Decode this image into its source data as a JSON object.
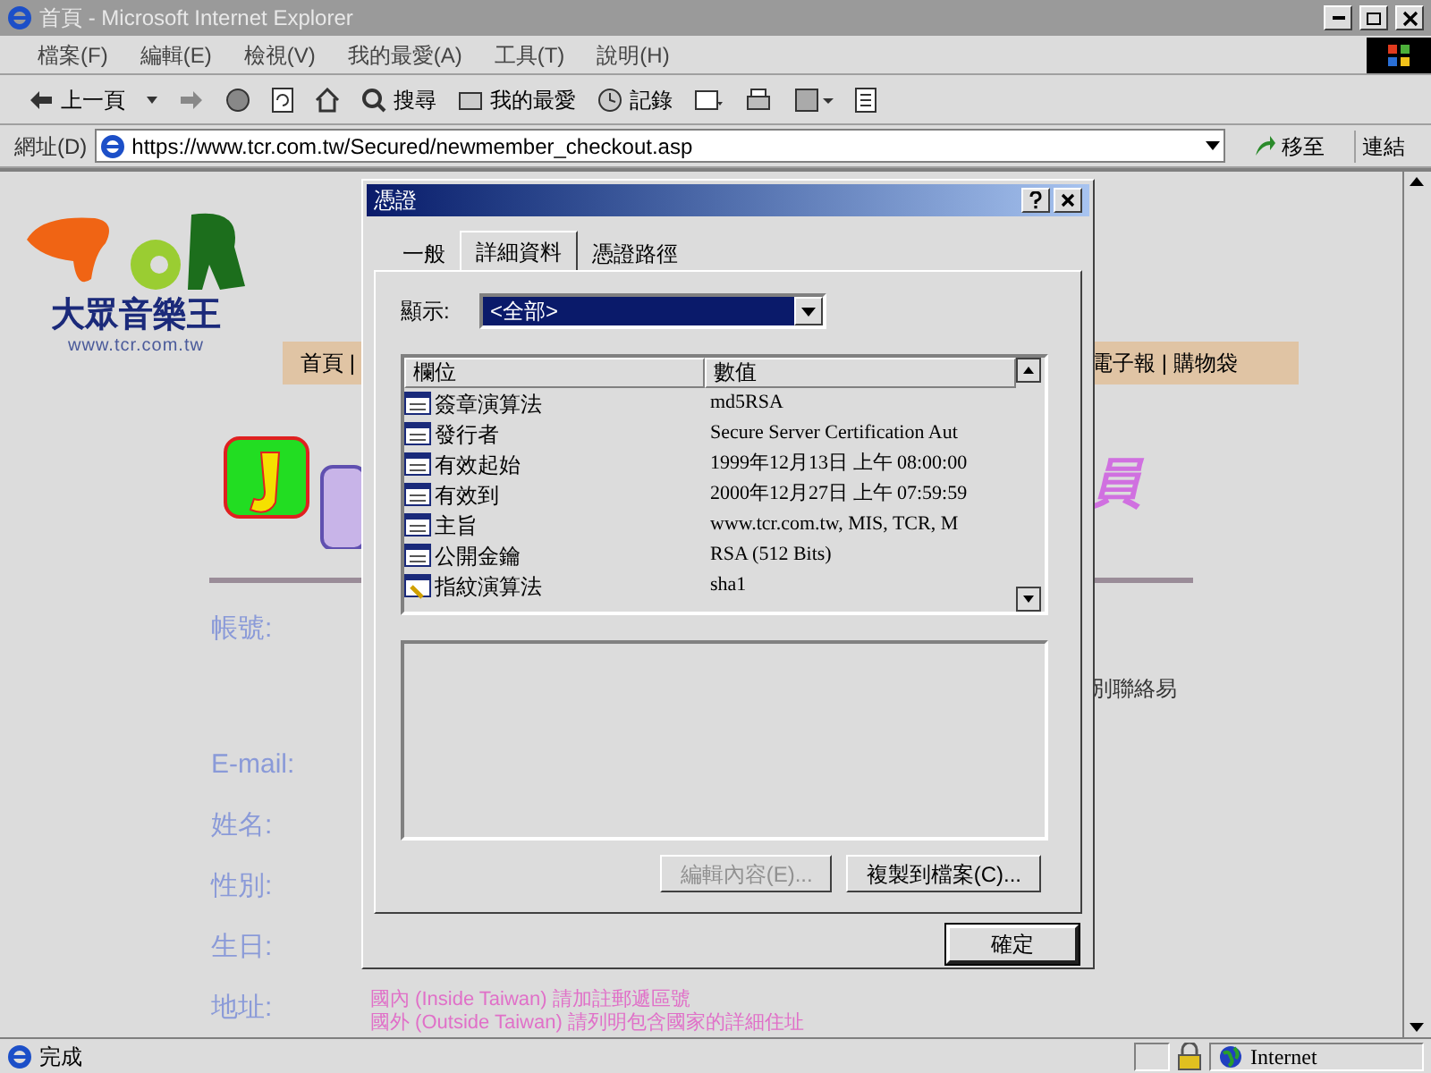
{
  "window": {
    "title": "首頁 - Microsoft Internet Explorer"
  },
  "menu_bar": [
    "檔案(F)",
    "編輯(E)",
    "檢視(V)",
    "我的最愛(A)",
    "工具(T)",
    "說明(H)"
  ],
  "toolbar": {
    "back": "上一頁",
    "search": "搜尋",
    "favorites": "我的最愛",
    "history": "記錄"
  },
  "address_bar": {
    "label": "網址(D)",
    "url": "https://www.tcr.com.tw/Secured/newmember_checkout.asp",
    "go": "移至",
    "links": "連結"
  },
  "page": {
    "logo_name": "大眾音樂王",
    "logo_url": "www.tcr.com.tw",
    "nav_left": "首頁 |",
    "nav_right": "電子報 | 購物袋",
    "heading_fragment": "員",
    "form_labels": [
      {
        "text": "帳號:",
        "kind": "gap"
      },
      {
        "text": "E-mail:",
        "kind": "plain"
      },
      {
        "text": "姓名:",
        "kind": "plain"
      },
      {
        "text": "性別:",
        "kind": "plain"
      },
      {
        "text": "生日:",
        "kind": "plain"
      },
      {
        "text": "地址:",
        "kind": "plain"
      }
    ],
    "side_note": "別聯絡易",
    "address_notes": [
      "國內 (Inside Taiwan) 請加註郵遞區號",
      "國外 (Outside Taiwan) 請列明包含國家的詳細住址"
    ]
  },
  "dialog": {
    "title": "憑證",
    "tabs": [
      {
        "label": "一般",
        "selected": false
      },
      {
        "label": "詳細資料",
        "selected": true
      },
      {
        "label": "憑證路徑",
        "selected": false
      }
    ],
    "show_label": "顯示:",
    "show_value": "<全部>",
    "columns": [
      "欄位",
      "數值"
    ],
    "rows": [
      {
        "field": "簽章演算法",
        "value": "md5RSA",
        "kind": "property"
      },
      {
        "field": "發行者",
        "value": "Secure Server Certification Aut",
        "kind": "property"
      },
      {
        "field": "有效起始",
        "value": "1999年12月13日 上午 08:00:00",
        "kind": "property"
      },
      {
        "field": "有效到",
        "value": "2000年12月27日 上午 07:59:59",
        "kind": "property"
      },
      {
        "field": "主旨",
        "value": "www.tcr.com.tw, MIS, TCR, M",
        "kind": "property"
      },
      {
        "field": "公開金鑰",
        "value": "RSA (512 Bits)",
        "kind": "property"
      },
      {
        "field": "指紋演算法",
        "value": "sha1",
        "kind": "extension"
      }
    ],
    "buttons": [
      {
        "label": "編輯內容(E)...",
        "disabled": true
      },
      {
        "label": "複製到檔案(C)...",
        "disabled": false
      }
    ],
    "ok": "確定"
  },
  "status_bar": {
    "text": "完成",
    "zone": "Internet"
  }
}
